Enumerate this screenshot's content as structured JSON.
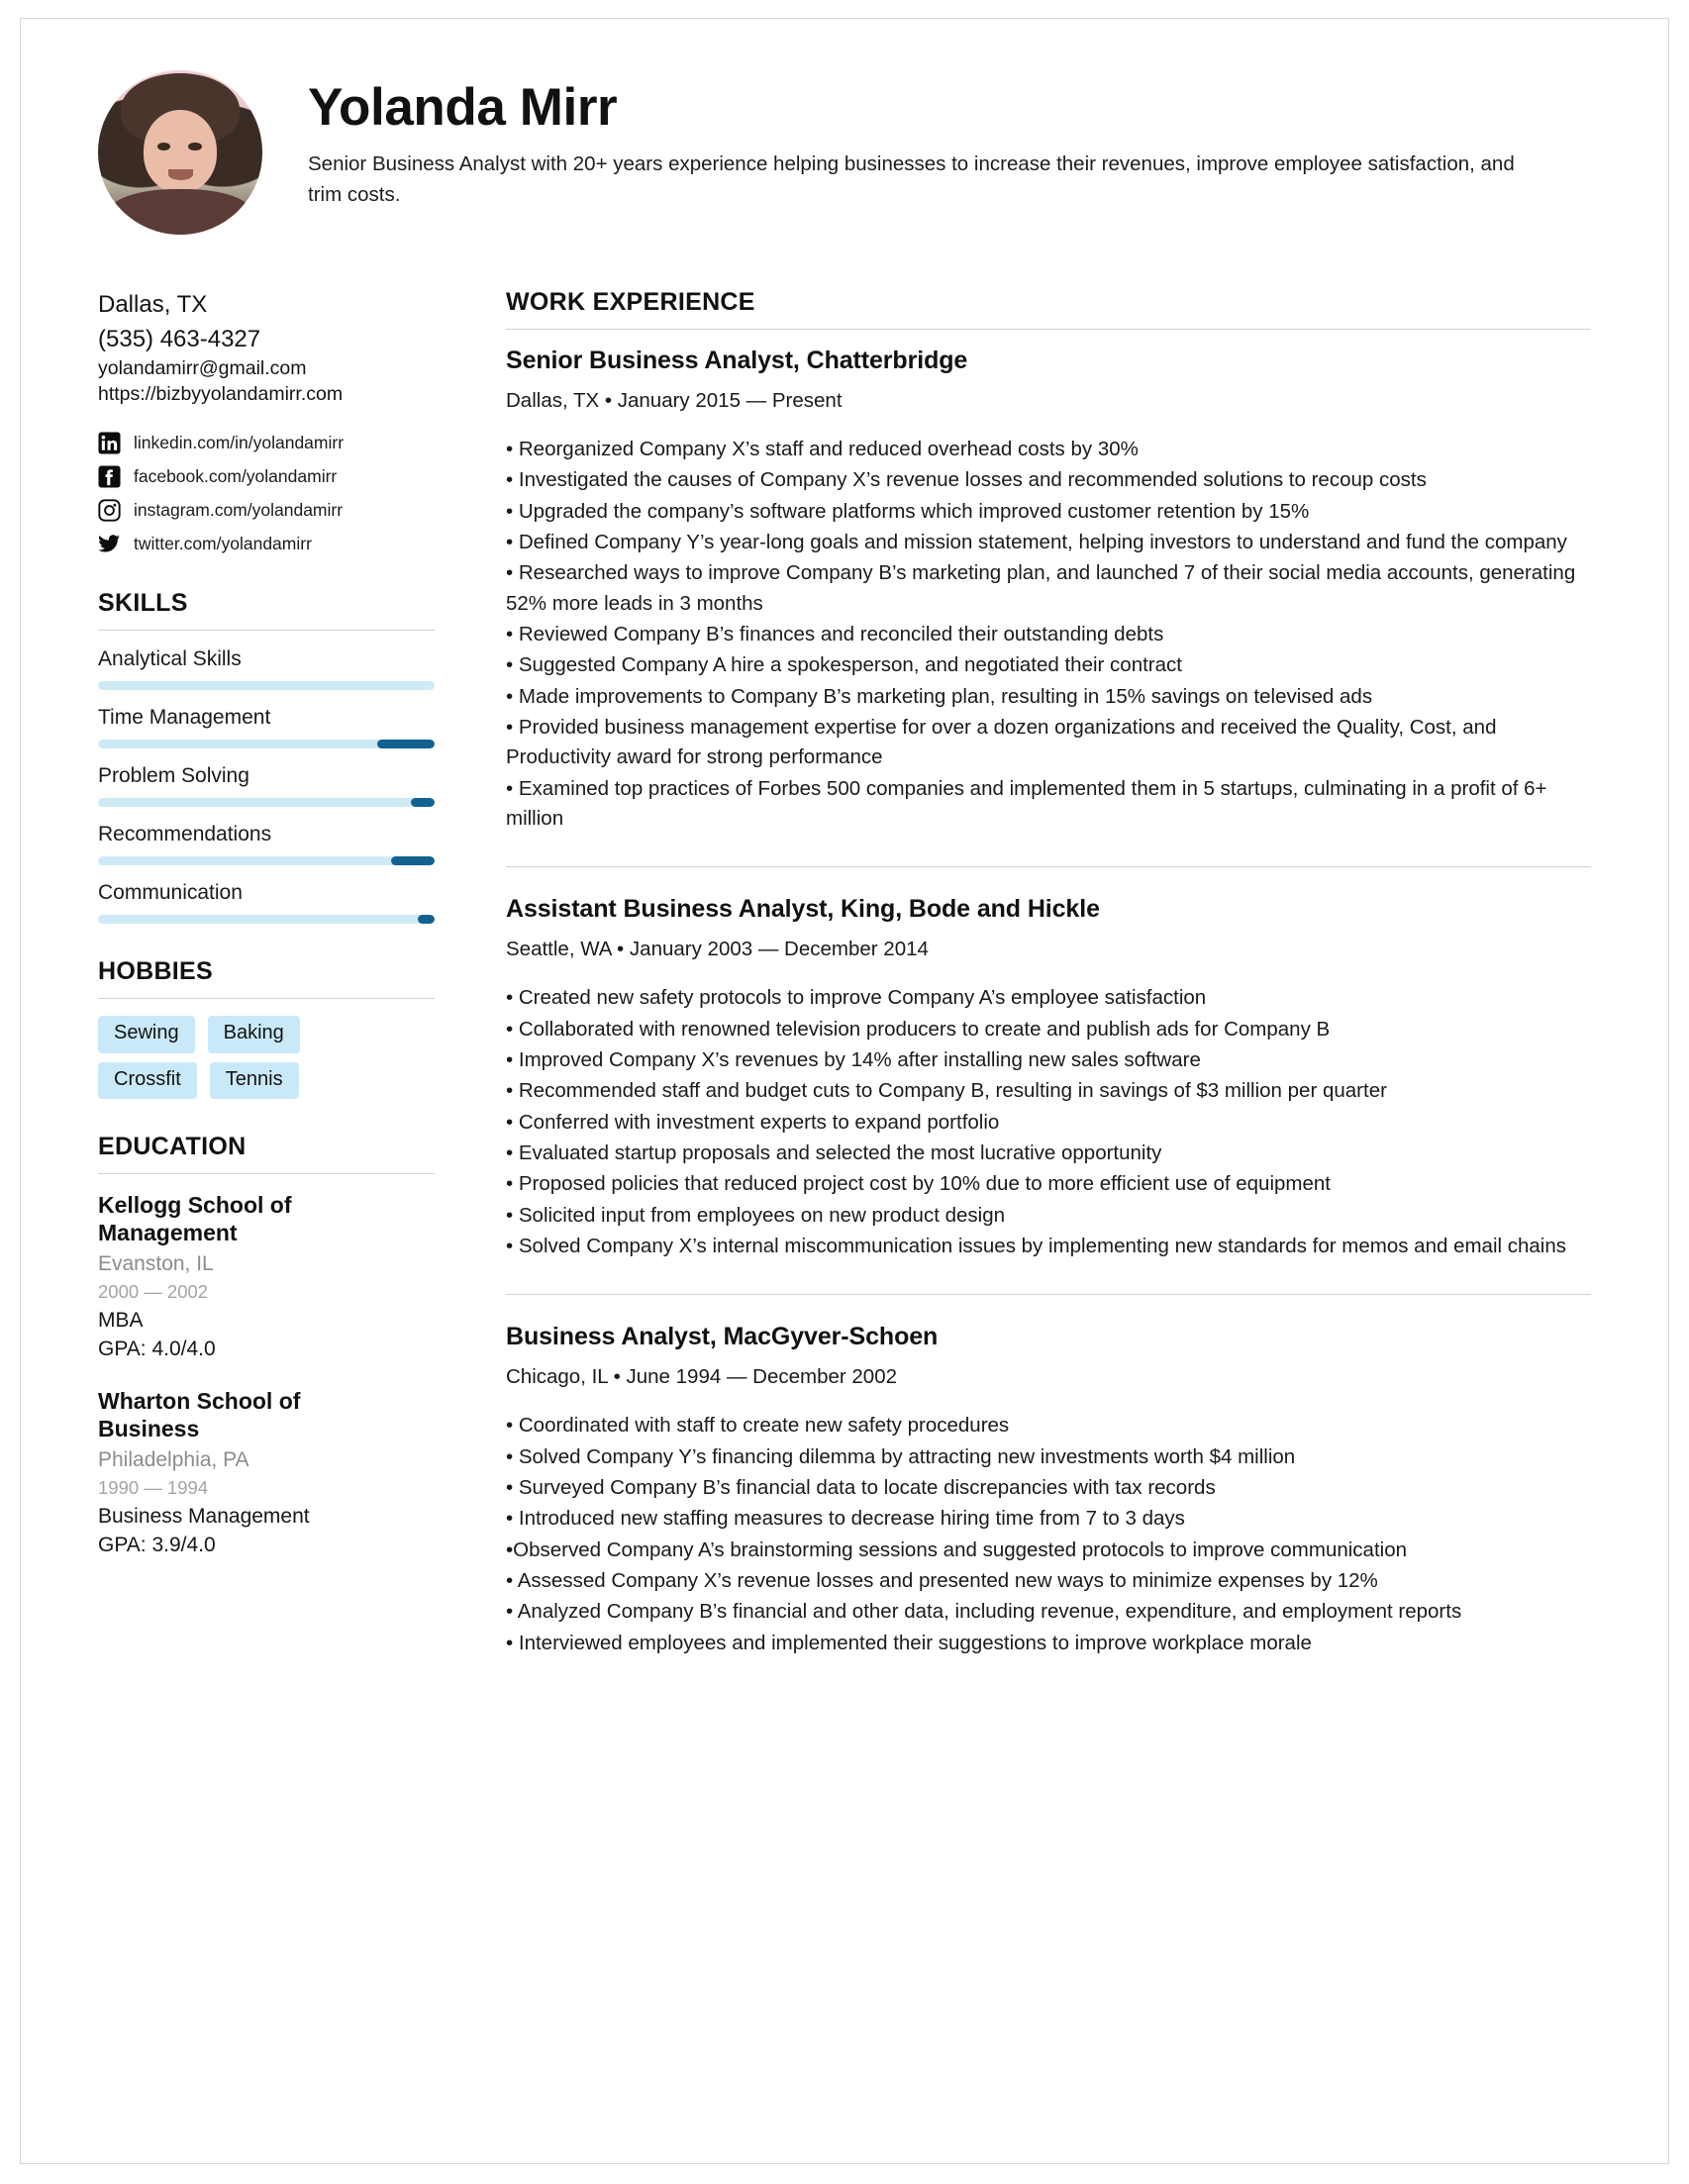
{
  "header": {
    "name": "Yolanda Mirr",
    "summary": "Senior Business Analyst with 20+ years experience helping businesses to increase their revenues, improve employee satisfaction, and trim costs.",
    "avatar_alt": "profile-photo"
  },
  "contact": {
    "location": "Dallas, TX",
    "phone": "(535) 463-4327",
    "email": "yolandamirr@gmail.com",
    "website": "https://bizbyyolandamirr.com"
  },
  "socials": [
    {
      "icon": "linkedin-icon",
      "text": "linkedin.com/in/yolandamirr"
    },
    {
      "icon": "facebook-icon",
      "text": "facebook.com/yolandamirr"
    },
    {
      "icon": "instagram-icon",
      "text": "instagram.com/yolandamirr"
    },
    {
      "icon": "twitter-icon",
      "text": "twitter.com/yolandamirr"
    }
  ],
  "skills": {
    "heading": "SKILLS",
    "items": [
      {
        "label": "Analytical Skills",
        "level": 100
      },
      {
        "label": "Time Management",
        "level": 83
      },
      {
        "label": "Problem Solving",
        "level": 93
      },
      {
        "label": "Recommendations",
        "level": 87
      },
      {
        "label": "Communication",
        "level": 95
      }
    ]
  },
  "hobbies": {
    "heading": "HOBBIES",
    "items": [
      "Sewing",
      "Baking",
      "Crossfit",
      "Tennis"
    ]
  },
  "education": {
    "heading": "EDUCATION",
    "items": [
      {
        "school": "Kellogg School of Management",
        "location": "Evanston, IL",
        "years": "2000 — 2002",
        "degree": "MBA",
        "gpa": "GPA: 4.0/4.0"
      },
      {
        "school": "Wharton School of Business",
        "location": "Philadelphia, PA",
        "years": "1990 — 1994",
        "degree": "Business Management",
        "gpa": "GPA: 3.9/4.0"
      }
    ]
  },
  "work": {
    "heading": "WORK EXPERIENCE",
    "jobs": [
      {
        "title": "Senior Business Analyst, Chatterbridge",
        "meta": "Dallas, TX • January 2015 — Present",
        "bullets": [
          "• Reorganized Company X’s staff and reduced overhead costs by 30%",
          "• Investigated the causes of Company X’s revenue losses and recommended solutions to recoup costs",
          "• Upgraded the company’s software platforms which improved customer retention by 15%",
          "• Defined Company Y’s year-long goals and mission statement, helping investors to understand and fund the company",
          "• Researched ways to improve Company B’s marketing plan, and launched 7 of their social media accounts, generating 52% more leads in 3 months",
          "• Reviewed Company B’s finances and reconciled their outstanding debts",
          "• Suggested Company A hire a spokesperson, and negotiated their contract",
          "• Made improvements to Company B’s marketing plan, resulting in 15% savings on televised ads",
          "• Provided business management expertise for over a dozen organizations and received the Quality, Cost, and Productivity award for strong performance",
          "• Examined top practices of Forbes 500 companies and implemented them in 5 startups, culminating in a profit of 6+ million"
        ]
      },
      {
        "title": "Assistant Business Analyst, King, Bode and Hickle",
        "meta": "Seattle, WA • January 2003 — December 2014",
        "bullets": [
          "• Created new safety protocols to improve Company A’s employee satisfaction",
          "• Collaborated with renowned television producers to create and publish ads for Company B",
          "• Improved Company X’s revenues by 14% after installing new sales software",
          "• Recommended staff and budget cuts to Company B, resulting in savings of $3 million per quarter",
          "• Conferred with investment experts to expand portfolio",
          "• Evaluated startup proposals and selected the most lucrative opportunity",
          "• Proposed policies that reduced project cost by 10% due to more efficient use of equipment",
          "• Solicited input from employees on new product design",
          "• Solved Company X’s internal miscommunication issues by implementing new standards for memos and email chains"
        ]
      },
      {
        "title": "Business Analyst, MacGyver-Schoen",
        "meta": "Chicago, IL • June 1994 — December 2002",
        "bullets": [
          "• Coordinated with staff to create new safety procedures",
          "• Solved Company Y’s financing dilemma by attracting new investments worth $4 million",
          "• Surveyed Company B’s financial data to locate discrepancies with tax records",
          "• Introduced new staffing measures to decrease hiring time from 7 to 3 days",
          "•Observed Company A’s brainstorming sessions and suggested protocols to improve communication",
          "• Assessed Company X’s revenue losses and presented new ways to minimize expenses by 12%",
          "• Analyzed Company B’s financial and other data, including revenue, expenditure, and employment reports",
          "• Interviewed employees and implemented their suggestions to improve workplace morale"
        ]
      }
    ]
  },
  "colors": {
    "skill_track": "#cfeaf7",
    "skill_fill": "#13618f",
    "hobby_bg": "#c9e9f8",
    "rule": "#d2d2d2",
    "muted": "#8c8c8c",
    "muted_light": "#a4a4a4"
  }
}
